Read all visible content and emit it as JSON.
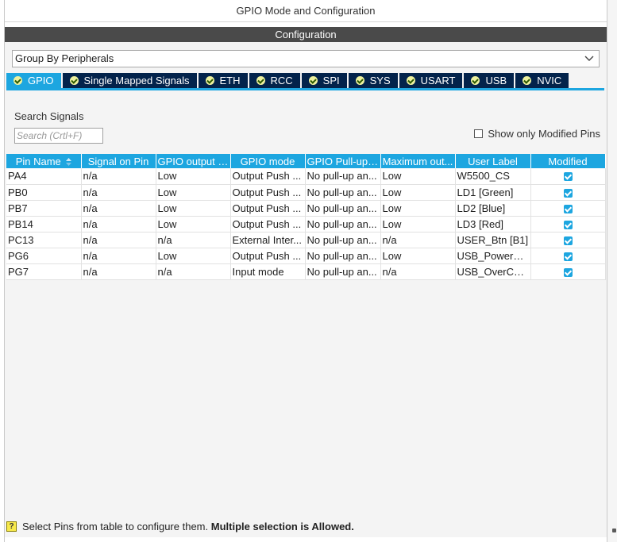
{
  "window": {
    "title": "GPIO Mode and Configuration"
  },
  "config": {
    "header": "Configuration",
    "group_by": "Group By Peripherals"
  },
  "tabs": [
    {
      "label": "GPIO",
      "active": true
    },
    {
      "label": "Single Mapped Signals",
      "active": false
    },
    {
      "label": "ETH",
      "active": false
    },
    {
      "label": "RCC",
      "active": false
    },
    {
      "label": "SPI",
      "active": false
    },
    {
      "label": "SYS",
      "active": false
    },
    {
      "label": "USART",
      "active": false
    },
    {
      "label": "USB",
      "active": false
    },
    {
      "label": "NVIC",
      "active": false
    }
  ],
  "search": {
    "label": "Search Signals",
    "placeholder": "Search (Crtl+F)"
  },
  "filter": {
    "show_modified_label": "Show only Modified Pins",
    "checked": false
  },
  "table": {
    "columns": [
      "Pin Name",
      "Signal on Pin",
      "GPIO output l...",
      "GPIO mode",
      "GPIO Pull-up/...",
      "Maximum out...",
      "User Label",
      "Modified"
    ],
    "rows": [
      [
        "PA4",
        "n/a",
        "Low",
        "Output Push ...",
        "No pull-up an...",
        "Low",
        "W5500_CS",
        true
      ],
      [
        "PB0",
        "n/a",
        "Low",
        "Output Push ...",
        "No pull-up an...",
        "Low",
        "LD1 [Green]",
        true
      ],
      [
        "PB7",
        "n/a",
        "Low",
        "Output Push ...",
        "No pull-up an...",
        "Low",
        "LD2 [Blue]",
        true
      ],
      [
        "PB14",
        "n/a",
        "Low",
        "Output Push ...",
        "No pull-up an...",
        "Low",
        "LD3 [Red]",
        true
      ],
      [
        "PC13",
        "n/a",
        "n/a",
        "External Inter...",
        "No pull-up an...",
        "n/a",
        "USER_Btn [B1]",
        true
      ],
      [
        "PG6",
        "n/a",
        "Low",
        "Output Push ...",
        "No pull-up an...",
        "Low",
        "USB_PowerS...",
        true
      ],
      [
        "PG7",
        "n/a",
        "n/a",
        "Input mode",
        "No pull-up an...",
        "n/a",
        "USB_OverCur...",
        true
      ]
    ]
  },
  "footer": {
    "text": "Select Pins from table to configure them.",
    "bold": "Multiple selection is Allowed."
  },
  "colors": {
    "accent": "#1da6e0",
    "tab_dark": "#03234b",
    "header_bg": "#4a4a4a"
  }
}
